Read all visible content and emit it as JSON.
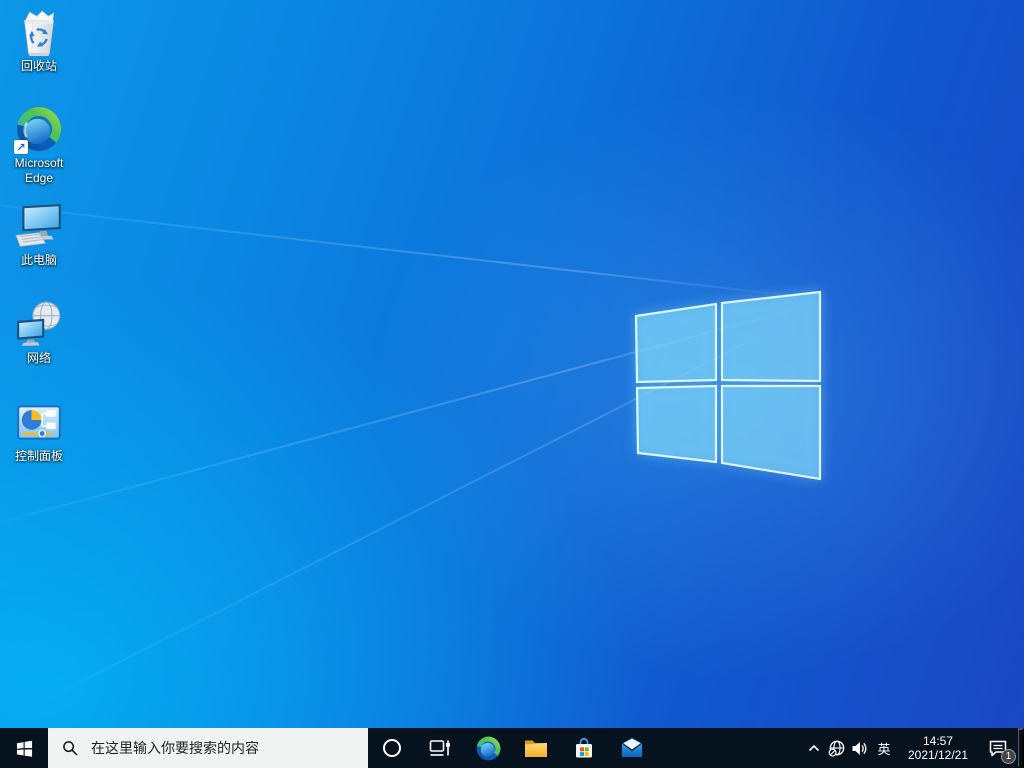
{
  "desktop": {
    "icons": [
      {
        "name": "recycle-bin",
        "label": "回收站"
      },
      {
        "name": "microsoft-edge-shortcut",
        "label": "Microsoft Edge"
      },
      {
        "name": "this-pc",
        "label": "此电脑"
      },
      {
        "name": "network",
        "label": "网络"
      },
      {
        "name": "control-panel",
        "label": "控制面板"
      }
    ],
    "wallpaper_logo": "windows-logo"
  },
  "taskbar": {
    "start": {
      "icon": "windows-logo-icon"
    },
    "search": {
      "icon": "search-icon",
      "placeholder": "在这里输入你要搜索的内容"
    },
    "pinned_icons": [
      "cortana-icon",
      "task-view-icon",
      "edge-icon",
      "file-explorer-icon",
      "store-icon",
      "mail-icon"
    ],
    "tray": {
      "chevron_icon": "chevron-up-icon",
      "network_icon": "network-globe-offline-icon",
      "volume_icon": "volume-icon",
      "ime_label": "英",
      "clock": {
        "time": "14:57",
        "date": "2021/12/21"
      },
      "action_center": {
        "icon": "action-center-icon",
        "badge": "1"
      }
    }
  },
  "colors": {
    "taskbar_bg": "#06131f",
    "wallpaper_top_left": "#0c97e8",
    "wallpaper_top_right": "#1b47c4",
    "wallpaper_bottom_left": "#00aeef",
    "wallpaper_bottom_right": "#1547c0",
    "logo_pane_fill": "#62bbf0",
    "logo_pane_stroke": "#e4faff",
    "search_box_bg": "#f1f2f2",
    "search_text": "#232323",
    "ms_logo_red": "#f25022",
    "ms_logo_green": "#7fba00",
    "ms_logo_blue": "#00a4ef",
    "ms_logo_yellow": "#ffb900"
  }
}
